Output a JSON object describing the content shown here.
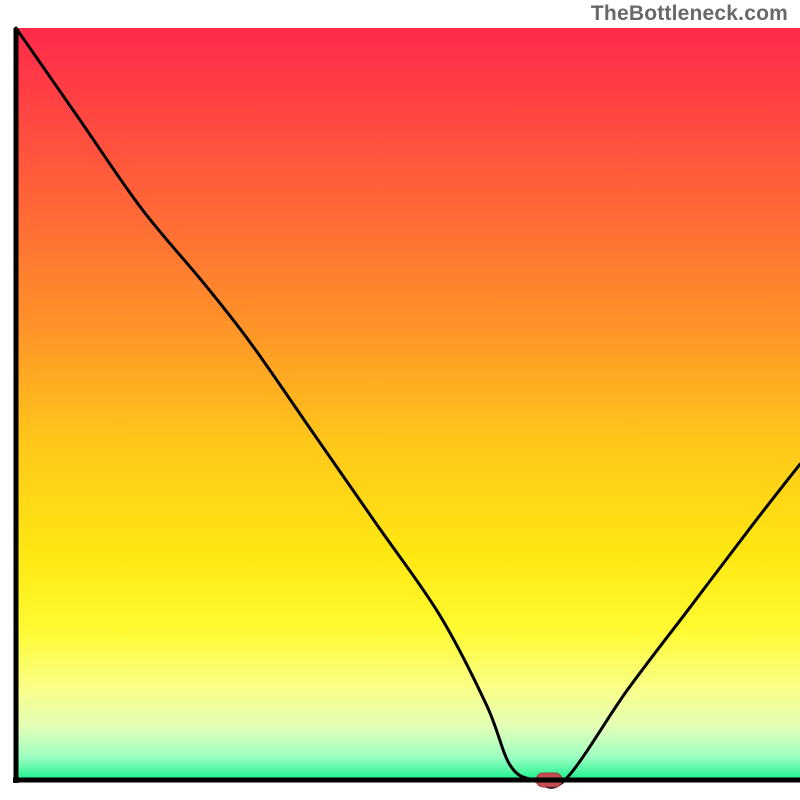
{
  "header": {
    "watermark": "TheBottleneck.com"
  },
  "colors": {
    "axis": "#000000",
    "curve_stroke": "#000000",
    "marker_fill": "#c24d52",
    "marker_stroke": "#a1393e",
    "gradient_stops": [
      {
        "offset": 0.0,
        "color": "#ff2a4b"
      },
      {
        "offset": 0.1,
        "color": "#ff4243"
      },
      {
        "offset": 0.25,
        "color": "#ff6a36"
      },
      {
        "offset": 0.4,
        "color": "#ff9428"
      },
      {
        "offset": 0.55,
        "color": "#ffc71a"
      },
      {
        "offset": 0.7,
        "color": "#ffe812"
      },
      {
        "offset": 0.8,
        "color": "#fffb32"
      },
      {
        "offset": 0.88,
        "color": "#f9ff8a"
      },
      {
        "offset": 0.93,
        "color": "#e2ffb8"
      },
      {
        "offset": 0.97,
        "color": "#9bffc2"
      },
      {
        "offset": 1.0,
        "color": "#19f08e"
      }
    ]
  },
  "chart_data": {
    "type": "line",
    "x": [
      0.0,
      0.08,
      0.16,
      0.24,
      0.3,
      0.38,
      0.46,
      0.54,
      0.6,
      0.63,
      0.66,
      0.7,
      0.78,
      0.86,
      0.94,
      1.0
    ],
    "values": [
      1.0,
      0.88,
      0.76,
      0.66,
      0.58,
      0.46,
      0.34,
      0.22,
      0.1,
      0.02,
      0.0,
      0.0,
      0.12,
      0.23,
      0.34,
      0.42
    ],
    "title": "",
    "xlabel": "",
    "ylabel": "",
    "xlim": [
      0,
      1
    ],
    "ylim": [
      0,
      1
    ],
    "marker": {
      "x": 0.68,
      "y": 0.0
    }
  }
}
